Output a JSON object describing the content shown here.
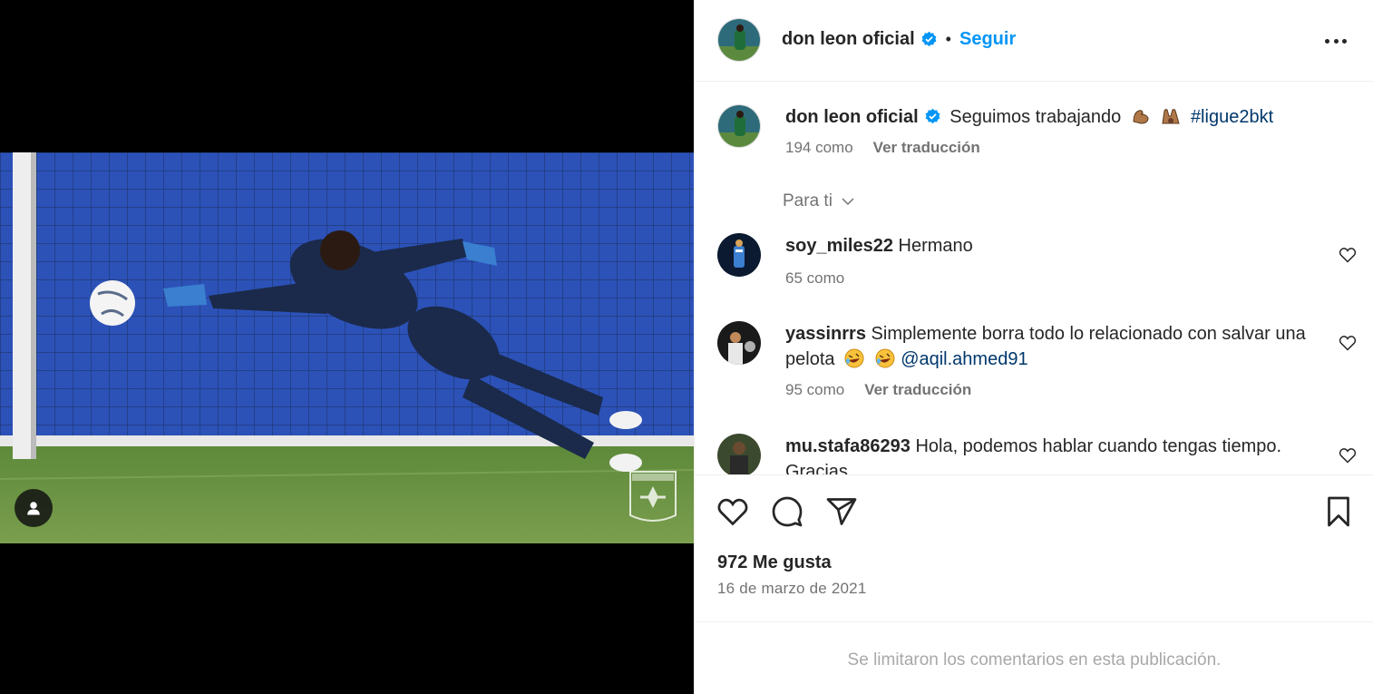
{
  "post": {
    "author": "don leon oficial",
    "follow_label": "Seguir",
    "more_icon": "more-options-icon",
    "caption": {
      "username": "don leon oficial",
      "text": "Seguimos trabajando",
      "emojis": [
        "flexed-biceps-emoji",
        "raising-hands-emoji"
      ],
      "hashtag": "#ligue2bkt",
      "likes": "194 como",
      "translate": "Ver traducción"
    },
    "filter_label": "Para ti",
    "media": {
      "watermark": "AJ AUXERRE",
      "tag_icon": "user-tag-icon"
    }
  },
  "comments": [
    {
      "username": "soy_miles22",
      "text": "Hermano",
      "likes": "65 como",
      "translate": ""
    },
    {
      "username": "yassinrrs",
      "text": "Simplemente borra todo lo relacionado con salvar una pelota",
      "emojis": [
        "rofl-emoji",
        "rofl-emoji"
      ],
      "mention": "@aqil.ahmed91",
      "likes": "95 como",
      "translate": "Ver traducción"
    },
    {
      "username": "mu.stafa86293",
      "text": "Hola, podemos hablar cuando tengas tiempo. Gracias",
      "likes": "",
      "translate": ""
    }
  ],
  "actions": {
    "like_icon": "heart-icon",
    "comment_icon": "comment-icon",
    "share_icon": "send-icon",
    "save_icon": "bookmark-icon"
  },
  "stats": {
    "likes": "972 Me gusta",
    "date": "16 de marzo de 2021"
  },
  "footer": {
    "limited_text": "Se limitaron los comentarios en esta publicación."
  },
  "colors": {
    "link_blue": "#0095f6",
    "hashtag_blue": "#00376b",
    "muted": "#737373",
    "verified": "#0095f6"
  }
}
